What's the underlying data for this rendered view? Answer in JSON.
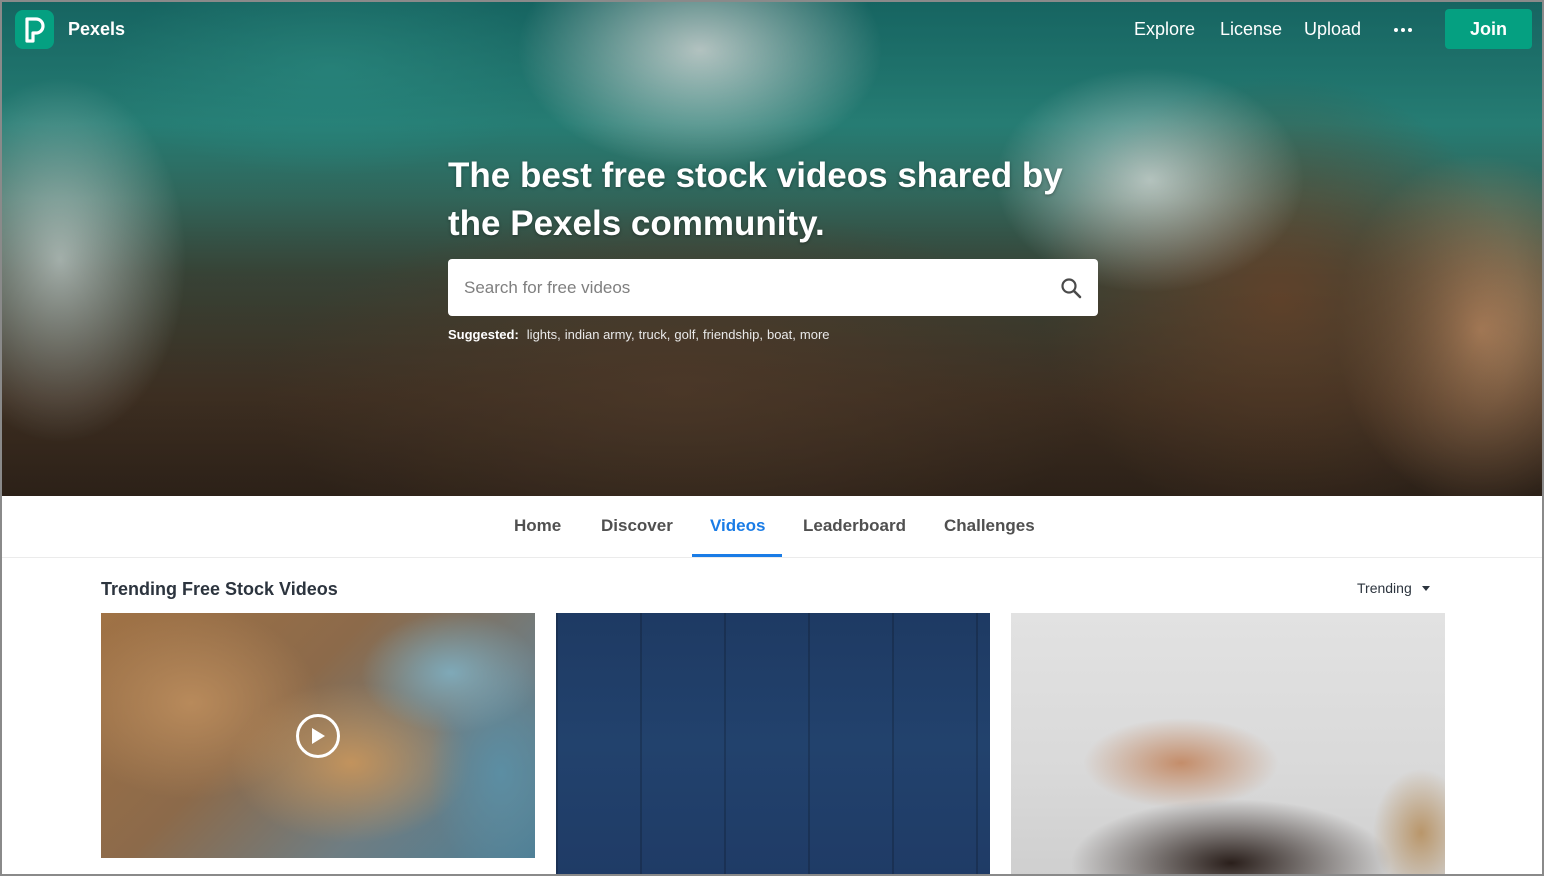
{
  "brand": {
    "name": "Pexels",
    "accent": "#05a081"
  },
  "nav": {
    "links": [
      "Explore",
      "License",
      "Upload"
    ],
    "more_icon": "ellipsis-icon",
    "join_label": "Join"
  },
  "hero": {
    "title": "The best free stock videos shared by the Pexels community.",
    "search_placeholder": "Search for free videos",
    "suggested_label": "Suggested:",
    "suggested_items": [
      "lights,",
      "indian army,",
      "truck,",
      "golf,",
      "friendship,",
      "boat,",
      "more"
    ]
  },
  "tabs": {
    "items": [
      "Home",
      "Discover",
      "Videos",
      "Leaderboard",
      "Challenges"
    ],
    "active": "Videos",
    "active_color": "#1a7ce6"
  },
  "section": {
    "title": "Trending Free Stock Videos",
    "sort_label": "Trending"
  },
  "videos": [
    {
      "thumbnail": "aerial-city-river",
      "has_play_icon": true
    },
    {
      "thumbnail": "blue-wooden-floor",
      "has_play_icon": false
    },
    {
      "thumbnail": "hands-flowers-hair",
      "has_play_icon": false
    }
  ]
}
